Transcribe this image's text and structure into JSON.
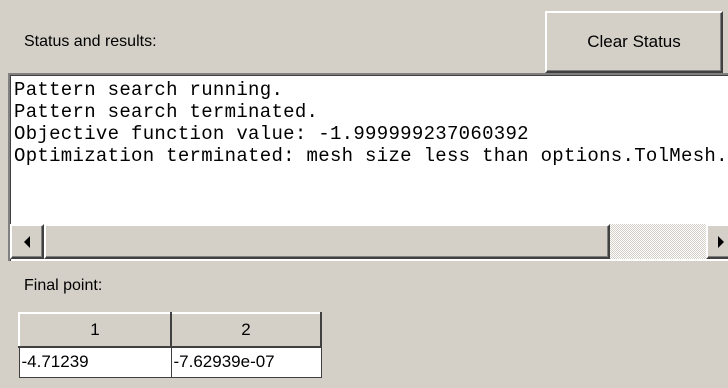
{
  "status_panel": {
    "label": "Status and results:",
    "clear_button_label": "Clear Status",
    "lines": [
      "Pattern search running.",
      "Pattern search terminated.",
      "Objective function value: -1.999999237060392",
      "Optimization terminated: mesh size less than options.TolMesh."
    ],
    "scroll_position": 0
  },
  "final_point": {
    "label": "Final point:",
    "columns": [
      "1",
      "2"
    ],
    "values": [
      "-4.71239",
      "-7.62939e-07"
    ]
  }
}
